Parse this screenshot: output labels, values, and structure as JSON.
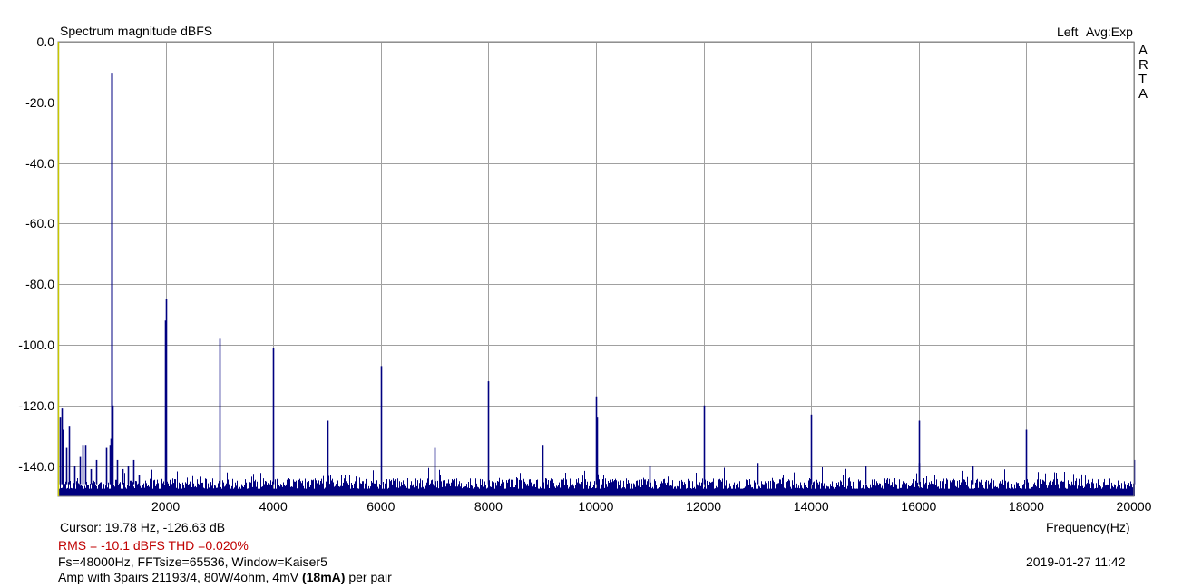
{
  "chart_data": {
    "type": "line",
    "title": "Spectrum magnitude dBFS",
    "channel_label": "Left",
    "averaging_label": "Avg:Exp",
    "watermark": "ARTA",
    "xlabel": "Frequency(Hz)",
    "ylabel": "",
    "xlim": [
      0,
      20000
    ],
    "ylim": [
      -150,
      0
    ],
    "x_ticks": [
      "2000",
      "4000",
      "6000",
      "8000",
      "10000",
      "12000",
      "14000",
      "16000",
      "18000",
      "20000"
    ],
    "y_ticks": [
      "0.0",
      "-20.0",
      "-40.0",
      "-60.0",
      "-80.0",
      "-100.0",
      "-120.0",
      "-140.0"
    ],
    "grid": true,
    "series_color": "#000080",
    "noise_floor_db": -146,
    "peaks": [
      {
        "x": 30,
        "y": -124
      },
      {
        "x": 60,
        "y": -121
      },
      {
        "x": 90,
        "y": -128
      },
      {
        "x": 150,
        "y": -134
      },
      {
        "x": 200,
        "y": -127
      },
      {
        "x": 300,
        "y": -140
      },
      {
        "x": 400,
        "y": -137
      },
      {
        "x": 450,
        "y": -133
      },
      {
        "x": 500,
        "y": -133
      },
      {
        "x": 600,
        "y": -141
      },
      {
        "x": 700,
        "y": -138
      },
      {
        "x": 900,
        "y": -134
      },
      {
        "x": 960,
        "y": -133
      },
      {
        "x": 980,
        "y": -131
      },
      {
        "x": 1000,
        "y": -10.5
      },
      {
        "x": 1020,
        "y": -120
      },
      {
        "x": 1100,
        "y": -138
      },
      {
        "x": 1200,
        "y": -141
      },
      {
        "x": 1300,
        "y": -140
      },
      {
        "x": 1400,
        "y": -138
      },
      {
        "x": 1500,
        "y": -143
      },
      {
        "x": 1985,
        "y": -92
      },
      {
        "x": 2000,
        "y": -85
      },
      {
        "x": 3000,
        "y": -98
      },
      {
        "x": 4000,
        "y": -101
      },
      {
        "x": 5000,
        "y": -125
      },
      {
        "x": 6000,
        "y": -107
      },
      {
        "x": 7000,
        "y": -134
      },
      {
        "x": 8000,
        "y": -112
      },
      {
        "x": 9000,
        "y": -133
      },
      {
        "x": 10000,
        "y": -117
      },
      {
        "x": 10010,
        "y": -124
      },
      {
        "x": 11000,
        "y": -140
      },
      {
        "x": 12000,
        "y": -120
      },
      {
        "x": 13000,
        "y": -139
      },
      {
        "x": 14000,
        "y": -123
      },
      {
        "x": 15000,
        "y": -140
      },
      {
        "x": 16000,
        "y": -125
      },
      {
        "x": 16010,
        "y": -139
      },
      {
        "x": 17000,
        "y": -140
      },
      {
        "x": 18000,
        "y": -128
      },
      {
        "x": 20000,
        "y": -138
      }
    ]
  },
  "footer": {
    "cursor": "Cursor: 19.78 Hz, -126.63 dB",
    "rms_thd": "RMS =  -10.1 dBFS   THD =0.020%",
    "fft_info": "Fs=48000Hz, FFTsize=65536, Window=Kaiser5",
    "timestamp": "2019-01-27  11:42",
    "desc_prefix": "Amp with 3pairs 21193/4, 80W/4ohm, 4mV ",
    "desc_bold": "(18mA)",
    "desc_suffix": " per pair"
  }
}
